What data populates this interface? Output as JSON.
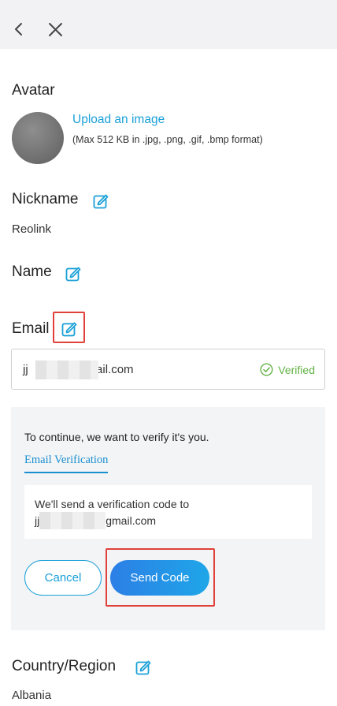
{
  "header": {
    "back_icon": "chevron-left-icon",
    "close_icon": "close-icon"
  },
  "avatar": {
    "label": "Avatar",
    "upload_link": "Upload an image",
    "upload_note": "(Max 512 KB in .jpg, .png, .gif, .bmp format)"
  },
  "nickname": {
    "label": "Nickname",
    "value": "Reolink"
  },
  "name": {
    "label": "Name"
  },
  "email": {
    "label": "Email",
    "value_start": "jj",
    "value_end": "nail.com",
    "status": "Verified"
  },
  "verification": {
    "intro": "To continue, we want to verify it's you.",
    "tab": "Email Verification",
    "message_line1": "We'll send a verification code to",
    "message_start": "jj",
    "message_end": "gmail.com",
    "cancel": "Cancel",
    "send": "Send Code"
  },
  "country": {
    "label": "Country/Region",
    "value": "Albania"
  },
  "colors": {
    "accent": "#1aa0d8",
    "verified": "#63b246",
    "highlight": "#e0413a"
  }
}
